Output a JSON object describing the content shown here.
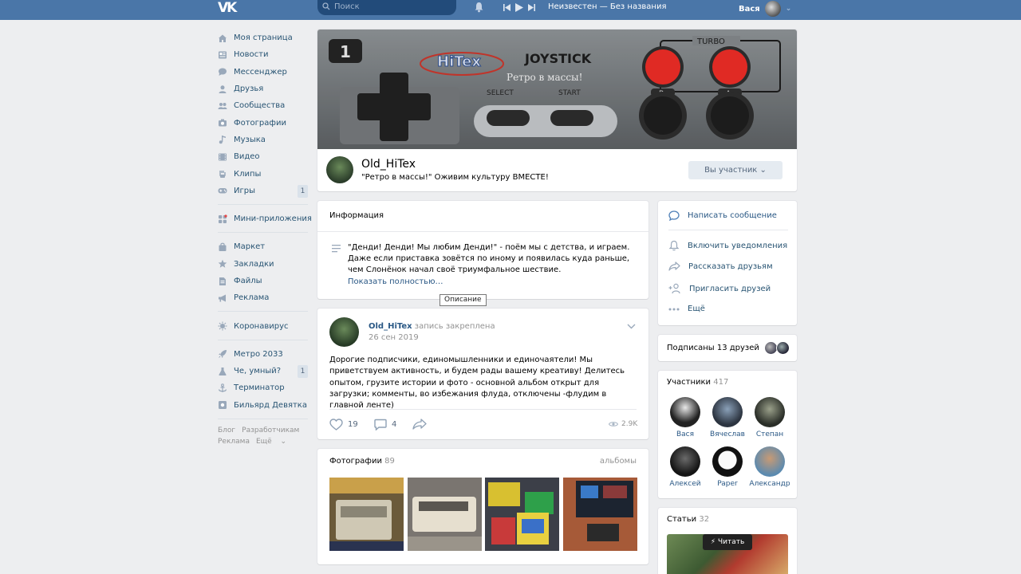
{
  "header": {
    "logo": "VK",
    "search_placeholder": "Поиск",
    "track": "Неизвестен — Без названия",
    "user_name": "Вася"
  },
  "nav": {
    "items": [
      {
        "label": "Моя страница",
        "icon": "home-icon"
      },
      {
        "label": "Новости",
        "icon": "news-icon"
      },
      {
        "label": "Мессенджер",
        "icon": "messenger-icon"
      },
      {
        "label": "Друзья",
        "icon": "friends-icon"
      },
      {
        "label": "Сообщества",
        "icon": "groups-icon"
      },
      {
        "label": "Фотографии",
        "icon": "camera-icon"
      },
      {
        "label": "Музыка",
        "icon": "music-icon"
      },
      {
        "label": "Видео",
        "icon": "video-icon"
      },
      {
        "label": "Клипы",
        "icon": "clips-icon"
      },
      {
        "label": "Игры",
        "icon": "gamepad-icon",
        "count": "1"
      }
    ],
    "apps": "Мини-приложения",
    "items2": [
      {
        "label": "Маркет",
        "icon": "market-icon"
      },
      {
        "label": "Закладки",
        "icon": "star-icon"
      },
      {
        "label": "Файлы",
        "icon": "file-icon"
      },
      {
        "label": "Реклама",
        "icon": "megaphone-icon"
      }
    ],
    "corona": "Коронавирус",
    "items3": [
      {
        "label": "Метро 2033",
        "icon": "rocket-icon"
      },
      {
        "label": "Че, умный?",
        "icon": "flask-icon",
        "count": "1"
      },
      {
        "label": "Терминатор",
        "icon": "anchor-icon"
      },
      {
        "label": "Бильярд Девятка",
        "icon": "app-icon"
      }
    ],
    "footer": {
      "blog": "Блог",
      "dev": "Разработчикам",
      "ads": "Реклама",
      "more": "Ещё"
    }
  },
  "group": {
    "cover_badge": "1",
    "cover_brand": "HiTex",
    "cover_joystick": "JOYSTICK",
    "cover_turbo": "TURBO",
    "cover_slogan": "Ретро в массы!",
    "cover_select": "SELECT",
    "cover_start": "START",
    "cover_b": "B",
    "cover_a": "A",
    "name": "Old_HiTex",
    "status": "\"Ретро в массы!\" Оживим культуру ВМЕСТЕ!",
    "member_button": "Вы участник"
  },
  "info": {
    "title": "Информация",
    "text": "\"Денди! Денди! Мы любим Денди!\" - поём мы с детства, и играем. Даже если приставка зовётся по иному и появилась куда раньше, чем Слонёнок начал своё триумфальное шествие.",
    "more": "Показать полностью…",
    "tooltip": "Описание"
  },
  "post": {
    "author": "Old_HiTex",
    "pinned": "запись закреплена",
    "date": "26 сен 2019",
    "text": "Дорогие подписчики, единомышленники и единочаятели! Мы приветствуем активность, и будем рады вашему креативу! Делитесь опытом, грузите истории и фото - основной альбом открыт для загрузки; комменты, во избежания флуда, отключены -флудим в главной ленте)",
    "likes": "19",
    "comments": "4",
    "views": "2.9K"
  },
  "photos": {
    "title": "Фотографии",
    "count": "89",
    "albums": "альбомы"
  },
  "actions": {
    "message": "Написать сообщение",
    "notify": "Включить уведомления",
    "share": "Рассказать друзьям",
    "invite": "Пригласить друзей",
    "more": "Ещё"
  },
  "friends": {
    "text": "Подписаны 13 друзей"
  },
  "members": {
    "title": "Участники",
    "count": "417",
    "list": [
      {
        "name": "Вася"
      },
      {
        "name": "Вячеслав"
      },
      {
        "name": "Степан"
      },
      {
        "name": "Алексей"
      },
      {
        "name": "Paper"
      },
      {
        "name": "Александр"
      }
    ]
  },
  "articles": {
    "title": "Статьи",
    "count": "32",
    "read": "Читать"
  },
  "colors": {
    "header": "#4a76a8",
    "link": "#2a5885",
    "background": "#edeef0"
  }
}
